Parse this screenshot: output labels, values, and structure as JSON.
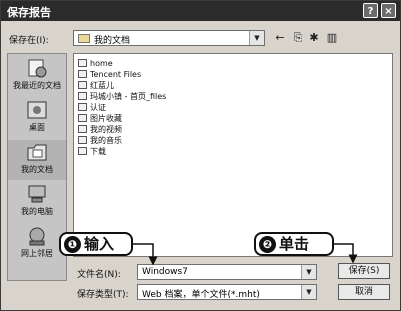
{
  "window": {
    "title": "保存报告",
    "help_label": "?",
    "close_label": "×"
  },
  "save_in": {
    "label": "保存在(I):",
    "value": "我的文档"
  },
  "toolbar": {
    "back": "←",
    "up": "⎘",
    "new_folder": "✱",
    "views": "▥"
  },
  "places": [
    {
      "label": "我最近的文档",
      "icon": "recent-docs-icon"
    },
    {
      "label": "桌面",
      "icon": "desktop-icon"
    },
    {
      "label": "我的文档",
      "icon": "my-documents-icon"
    },
    {
      "label": "我的电脑",
      "icon": "my-computer-icon"
    },
    {
      "label": "网上邻居",
      "icon": "network-icon"
    }
  ],
  "files": [
    "home",
    "Tencent Files",
    "红蓝儿",
    "玛城小镇 - 首页_files",
    "认证",
    "图片收藏",
    "我的视频",
    "我的音乐",
    "下载"
  ],
  "filename": {
    "label": "文件名(N):",
    "value": "Windows7"
  },
  "filetype": {
    "label": "保存类型(T):",
    "value": "Web 档案，单个文件(*.mht)"
  },
  "buttons": {
    "save": "保存(S)",
    "cancel": "取消"
  },
  "callouts": [
    {
      "number": "❶",
      "text": "输入"
    },
    {
      "number": "❷",
      "text": "单击"
    }
  ],
  "colors": {
    "titlebar": "#2b2b2b",
    "dialog_bg": "#d8d4cc",
    "list_bg": "#ffffff"
  }
}
